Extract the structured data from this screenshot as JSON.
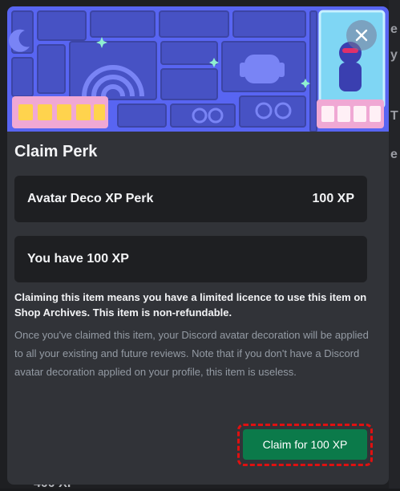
{
  "modal": {
    "title": "Claim Perk",
    "perk_name": "Avatar Deco XP Perk",
    "perk_cost": "100 XP",
    "balance_text": "You have 100 XP",
    "notice": "Claiming this item means you have a limited licence to use this item on Shop Archives. This item is non-refundable.",
    "description": "Once you've claimed this item, your Discord avatar decoration will be applied to all your existing and future reviews. Note that if you don't have a Discord avatar decoration applied on your profile, this item is useless.",
    "claim_button_label": "Claim for 100 XP",
    "close_icon": "close-icon"
  },
  "background": {
    "bottom_fragment": "400 XP",
    "right_fragments": [
      "e",
      "y",
      "T",
      "e"
    ]
  },
  "colors": {
    "banner_purple": "#5865f2",
    "claim_green": "#0b7a4a",
    "highlight_red": "#e01010"
  }
}
